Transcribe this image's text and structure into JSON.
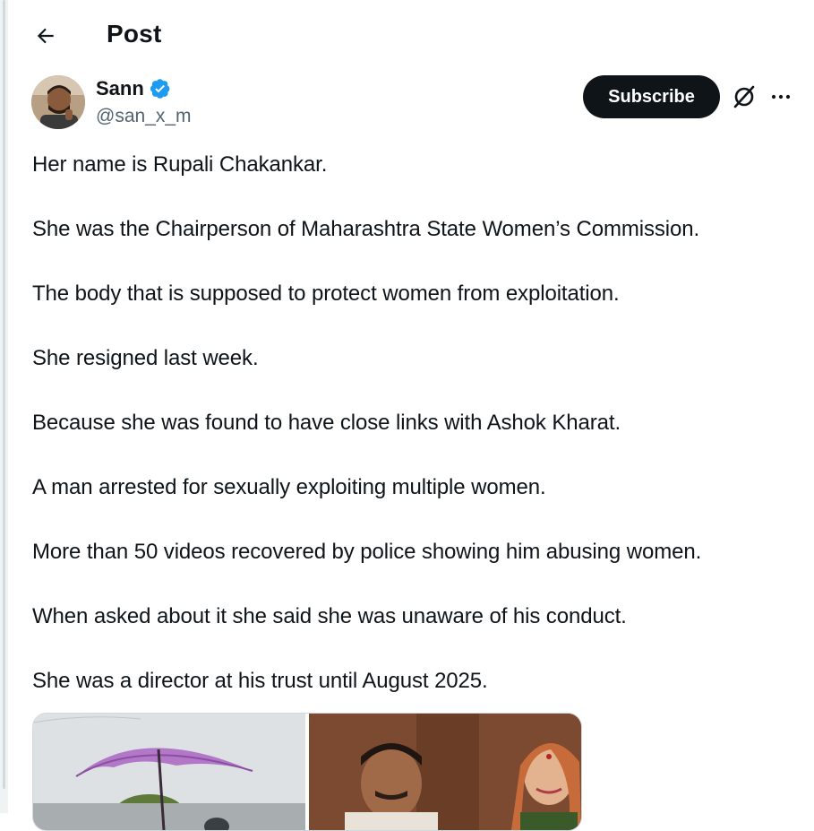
{
  "header": {
    "title": "Post"
  },
  "author": {
    "display_name": "Sann",
    "handle": "@san_x_m",
    "verified": true
  },
  "actions": {
    "subscribe_label": "Subscribe"
  },
  "post": {
    "paragraphs": [
      "Her name is Rupali Chakankar.",
      "She was the Chairperson of Maharashtra State Women’s Commission.",
      "The body that is supposed to protect women from exploitation.",
      "She resigned last week.",
      "Because she was found to have close links with Ashok Kharat.",
      "A man arrested for sexually exploiting multiple women.",
      "More than 50 videos recovered by police showing him abusing women.",
      "When asked about it she said she was unaware of his conduct.",
      "She was a director at his trust until August 2025."
    ]
  },
  "media": [
    {
      "description_icon": "photo-icon"
    },
    {
      "description_icon": "photo-icon"
    }
  ],
  "colors": {
    "text": "#0f1419",
    "secondary": "#536471",
    "verified": "#1d9bf0",
    "button_bg": "#0f1419"
  }
}
